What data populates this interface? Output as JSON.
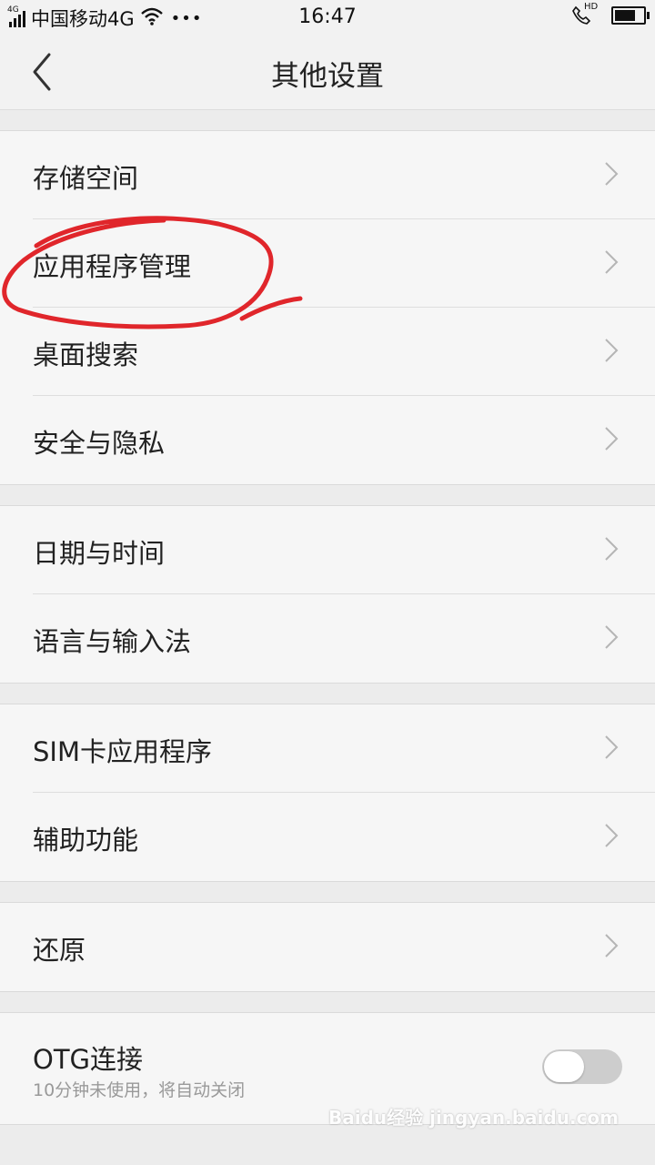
{
  "status_bar": {
    "network_tag": "4G",
    "carrier": "中国移动4G",
    "more": "•••",
    "time": "16:47",
    "hd_tag": "HD",
    "battery_level": 0.85
  },
  "header": {
    "title": "其他设置",
    "back_icon": "chevron-left-icon"
  },
  "groups": [
    {
      "items": [
        {
          "label": "存储空间"
        },
        {
          "label": "应用程序管理"
        },
        {
          "label": "桌面搜索"
        },
        {
          "label": "安全与隐私"
        }
      ]
    },
    {
      "items": [
        {
          "label": "日期与时间"
        },
        {
          "label": "语言与输入法"
        }
      ]
    },
    {
      "items": [
        {
          "label": "SIM卡应用程序"
        },
        {
          "label": "辅助功能"
        }
      ]
    },
    {
      "items": [
        {
          "label": "还原"
        }
      ]
    }
  ],
  "otg": {
    "label": "OTG连接",
    "subtitle": "10分钟未使用，将自动关闭",
    "enabled": false
  },
  "colors": {
    "annotation": "#e0262b",
    "toggle_off": "#cdcdcd"
  },
  "watermark": "Baidu经验 jingyan.baidu.com"
}
